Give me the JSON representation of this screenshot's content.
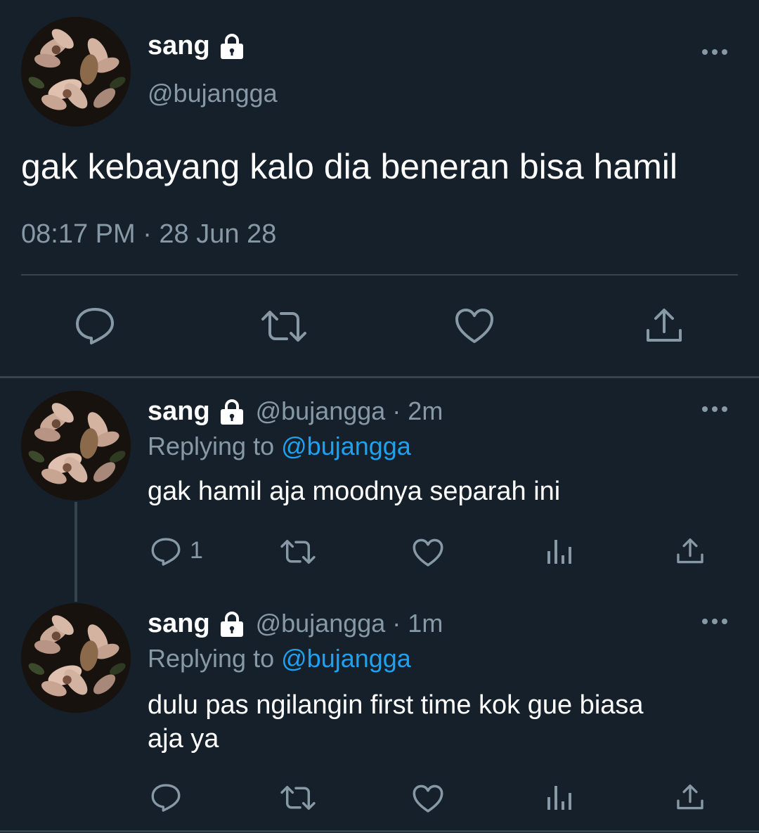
{
  "main_tweet": {
    "name": "sang",
    "handle": "@bujangga",
    "text": "gak kebayang kalo dia beneran bisa hamil",
    "timestamp": "08:17 PM · 28 Jun 28"
  },
  "replies": [
    {
      "name": "sang",
      "handle_time": "@bujangga · 2m",
      "replying_label": "Replying to",
      "replying_to": "@bujangga",
      "text": "gak hamil aja moodnya separah ini",
      "reply_count": "1"
    },
    {
      "name": "sang",
      "handle_time": "@bujangga · 1m",
      "replying_label": "Replying to",
      "replying_to": "@bujangga",
      "text_line1": "dulu pas ngilangin first time kok gue biasa",
      "text_line2": "aja ya",
      "reply_count": ""
    }
  ],
  "icons": {
    "lock": "lock-icon",
    "more": "more-icon",
    "reply": "reply-icon",
    "retweet": "retweet-icon",
    "like": "heart-icon",
    "share": "share-icon",
    "analytics": "analytics-icon"
  },
  "colors": {
    "background": "#15202b",
    "text": "#ffffff",
    "muted": "#8899a6",
    "link": "#1da1f2",
    "divider": "#38444d"
  }
}
